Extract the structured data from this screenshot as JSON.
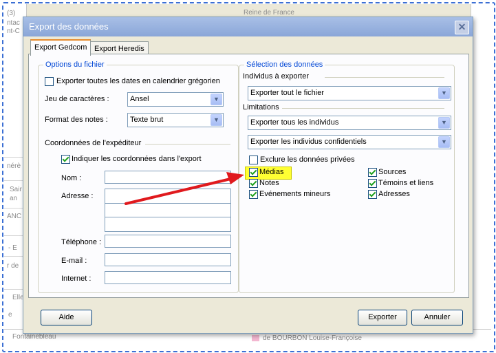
{
  "background": {
    "left_texts": [
      "(3)",
      "ntac",
      "nt-C",
      "nérè",
      "Sair",
      "an",
      "ANC",
      "- E",
      "r de",
      "Elle",
      "e",
      "Fontainebleau"
    ],
    "top_text": "Reine de France",
    "bottom_text": "de BOURBON Louise-Françoise"
  },
  "dialog": {
    "title": "Export des données",
    "close_label": "✕",
    "tabs": [
      "Export Gedcom",
      "Export Heredis"
    ]
  },
  "left_group": {
    "legend": "Options du fichier",
    "gregorian_label": "Exporter toutes les dates en calendrier grégorien",
    "charset_label": "Jeu de caractères :",
    "charset_value": "Ansel",
    "notes_label": "Format des notes :",
    "notes_value": "Texte brut",
    "sender_heading": "Coordonnées de l'expéditeur",
    "include_sender_label": "Indiquer les coordonnées dans l'export",
    "name_label": "Nom :",
    "address_label": "Adresse :",
    "phone_label": "Téléphone :",
    "email_label": "E-mail :",
    "internet_label": "Internet :"
  },
  "right_group": {
    "legend": "Sélection des données",
    "individuals_heading": "Individus à exporter",
    "individuals_value": "Exporter tout le fichier",
    "limits_heading": "Limitations",
    "limit1_value": "Exporter tous les individus",
    "limit2_value": "Exporter les individus confidentiels",
    "exclude_private_label": "Exclure les données privées",
    "checks": {
      "medias": "Médias",
      "notes": "Notes",
      "minor_events": "Evénements mineurs",
      "sources": "Sources",
      "witnesses": "Témoins et liens",
      "addresses": "Adresses"
    }
  },
  "buttons": {
    "help": "Aide",
    "export": "Exporter",
    "cancel": "Annuler"
  },
  "colors": {
    "legend": "#0046d5",
    "highlight": "#ffff33",
    "arrow": "#e0191d"
  }
}
